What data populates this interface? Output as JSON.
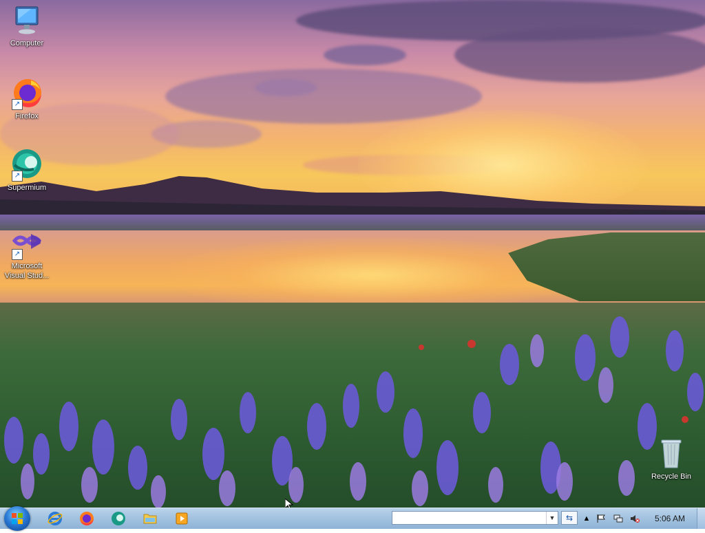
{
  "desktop": {
    "icons": [
      {
        "label": "Computer",
        "icon": "computer-icon"
      },
      {
        "label": "Firefox",
        "icon": "firefox-icon"
      },
      {
        "label": "Supermium",
        "icon": "supermium-icon"
      },
      {
        "label": "Microsoft Visual Stud...",
        "icon": "visual-studio-icon"
      },
      {
        "label": "Recycle Bin",
        "icon": "recycle-bin-icon"
      }
    ]
  },
  "taskbar": {
    "start_button": "start-orb-icon",
    "pinned": [
      "internet-explorer-icon",
      "firefox-icon",
      "supermium-icon",
      "file-explorer-icon",
      "media-player-icon"
    ],
    "address_bar": {
      "value": "",
      "placeholder": ""
    },
    "tray_icons": [
      "show-hidden-icons-arrow",
      "action-center-flag-icon",
      "network-icon",
      "volume-muted-icon"
    ],
    "clock": "5:06 AM"
  },
  "colors": {
    "taskbar": "#a4c3e0",
    "start_orb": "#2a7ad6",
    "icon_text": "#ffffff"
  }
}
